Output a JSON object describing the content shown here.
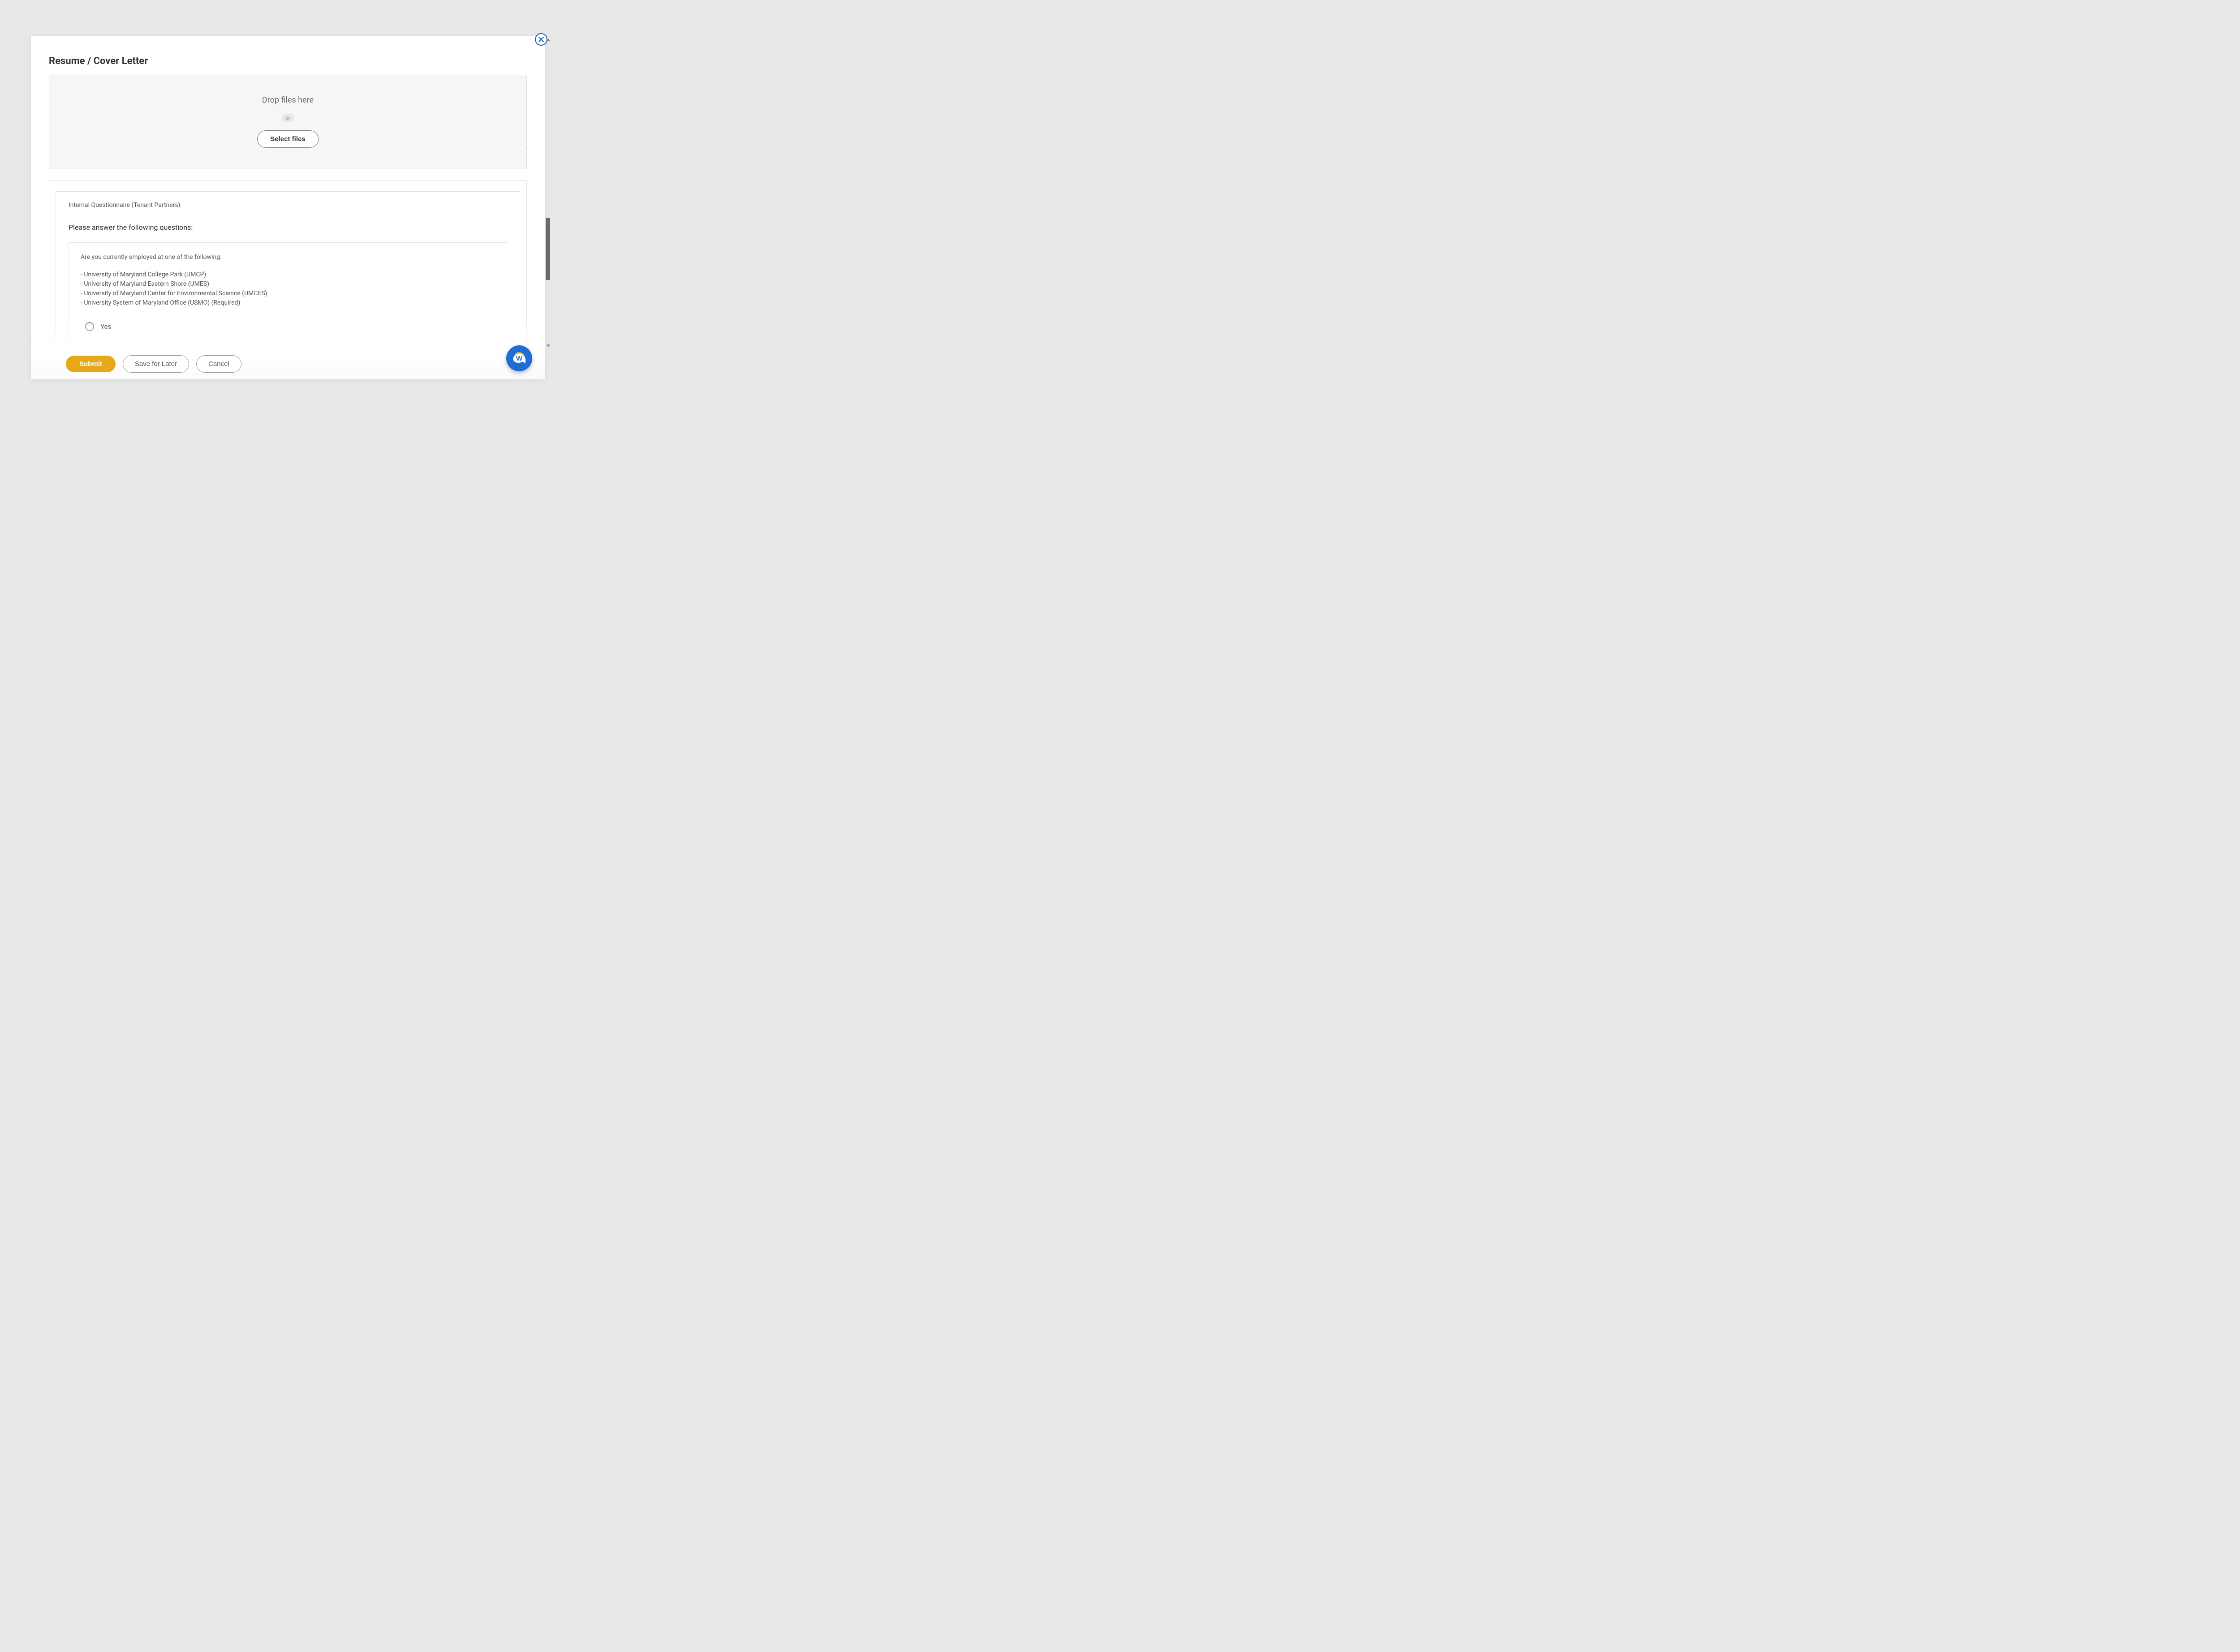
{
  "section": {
    "title": "Resume / Cover Letter"
  },
  "dropzone": {
    "drop_label": "Drop files here",
    "or_label": "or",
    "select_label": "Select files"
  },
  "questionnaire": {
    "title": "Internal Questionnaire (Tenant Partners)",
    "instruction": "Please answer the following questions:",
    "question": {
      "prompt": "Are you currently employed at one of the following:",
      "items": [
        "- University of Maryland College Park (UMCP)",
        "- University of Maryland Eastern Shore (UMES)",
        "- University of Maryland Center for Environmental Science (UMCES)",
        "- University System of Maryland Office (USMO) (Required)"
      ],
      "options": [
        {
          "label": "Yes"
        }
      ]
    }
  },
  "footer": {
    "submit_label": "Submit",
    "save_label": "Save for Later",
    "cancel_label": "Cancel"
  }
}
